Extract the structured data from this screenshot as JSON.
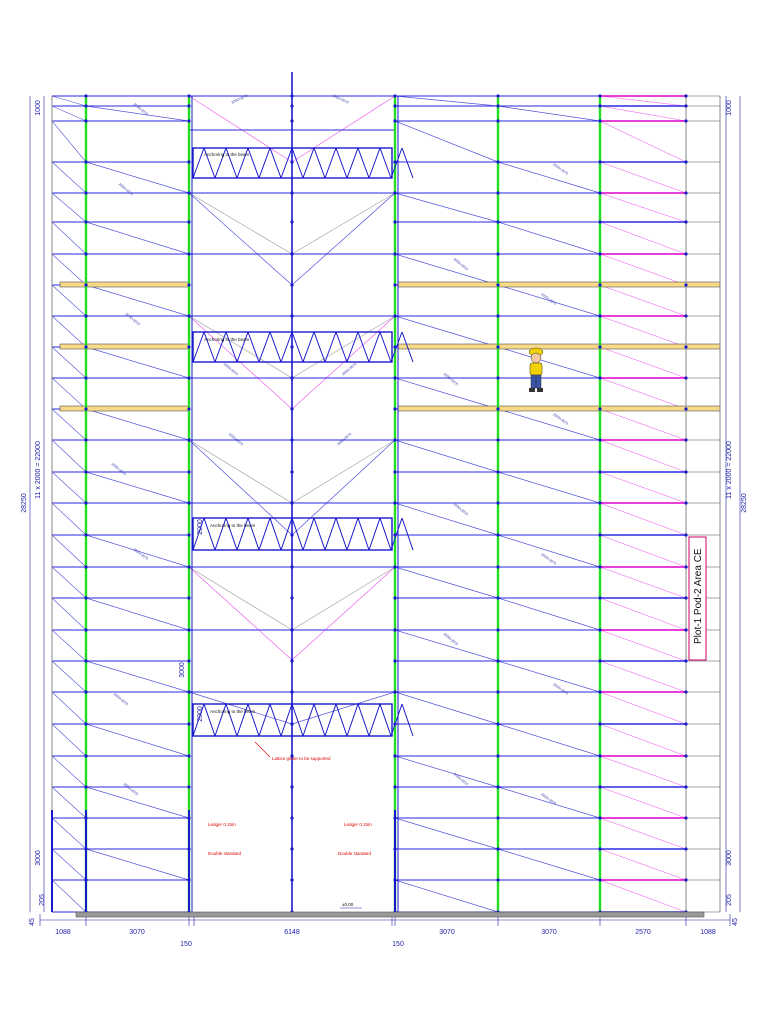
{
  "colors": {
    "standard_green": "#22dd22",
    "standard_blue": "#1a1acc",
    "ledger_blue": "#2a2ae0",
    "brace_blue": "#5555dd",
    "brace_pink": "#ee66ee",
    "ledger_magenta": "#dd00cc",
    "deck_yellow": "#f7d98a",
    "grey": "#888888",
    "dim_blue": "#2222aa",
    "red_note": "#dd0000"
  },
  "icons": [
    "worker-figure-icon",
    "area-label-box"
  ],
  "dimensions": {
    "bottom": [
      "1088",
      "3070",
      "150",
      "6148",
      "150",
      "3070",
      "3070",
      "2570",
      "1088"
    ],
    "left_total": "28250",
    "left_repeat": "11 x 2000 = 22000",
    "left_top": "1000",
    "left_bottom": "3000",
    "left_base_a": "45",
    "left_base_b": "205",
    "right_total": "28250",
    "right_repeat": "11 x 2000 = 22000",
    "right_top": "1000",
    "right_bottom": "3000",
    "right_base_a": "45",
    "right_base_b": "205",
    "mid_a": "2000",
    "mid_b": "2000",
    "mid_c": "3000"
  },
  "notes": {
    "anchoring": "Anchoring to the beam",
    "lattice": "Lattice girder to be supported",
    "ledger_left": "Ledger 0.15m",
    "ledger_right": "Ledger 0.15m",
    "double_left": "Double standard",
    "double_right": "Double standard",
    "base_level": "±0.00",
    "area_label": "Plot-1 Pod-2 Area CE",
    "brace_label": "2000×3070"
  }
}
